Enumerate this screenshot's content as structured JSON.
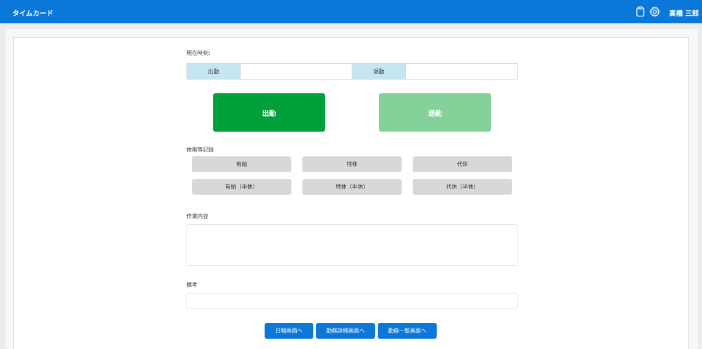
{
  "header": {
    "title": "タイムカード",
    "user_name": "高橋 三郎",
    "icons": [
      "clipboard-icon",
      "gear-icon"
    ],
    "bg_color": "#0a77d9"
  },
  "clock": {
    "current_time_label": "現在時刻:",
    "clock_in_label": "出勤",
    "clock_in_value": "",
    "clock_out_label": "退勤",
    "clock_out_value": ""
  },
  "actions": {
    "clock_in_button": "出勤",
    "clock_out_button": "退勤",
    "clock_in_color": "#02a03a",
    "clock_out_color": "#84d29a"
  },
  "leave": {
    "section_label": "休暇等記録",
    "buttons": [
      "有給",
      "特休",
      "代休",
      "有給（半休）",
      "特休（半休）",
      "代休（半休）"
    ]
  },
  "work": {
    "label": "作業内容",
    "value": ""
  },
  "notes": {
    "label": "備考",
    "value": ""
  },
  "nav": {
    "daily_report": "日報画面へ",
    "work_detail": "勤務詳細画面へ",
    "work_list": "勤務一覧画面へ"
  }
}
